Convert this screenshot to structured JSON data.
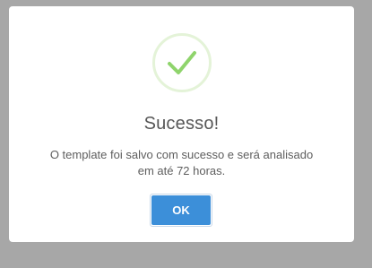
{
  "modal": {
    "icon": "check-icon",
    "title": "Sucesso!",
    "message_line1": "O template foi salvo com sucesso e será analisado",
    "message_line2": "em até 72 horas.",
    "ok_label": "OK"
  },
  "colors": {
    "overlay": "#a7a7a7",
    "success_check": "#8fd46c",
    "success_ring": "#e4f3d8",
    "button_primary": "#3c8fd9",
    "title_text": "#575757"
  }
}
